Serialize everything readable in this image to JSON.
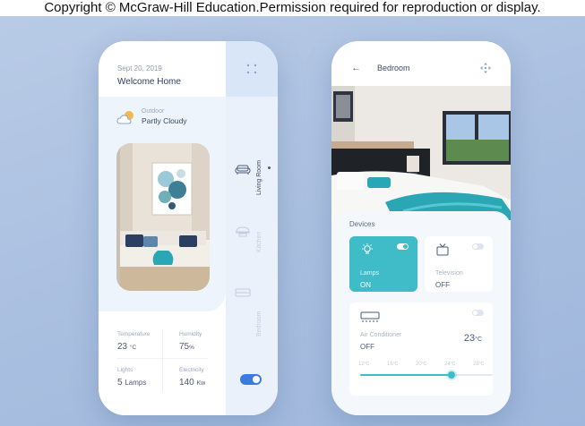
{
  "watermark": "Copyright © McGraw-Hill Education.Permission required for reproduction or display.",
  "colors": {
    "accent": "#3fbcc8",
    "toggle_blue": "#3b7be0",
    "text_dark": "#3a4a63"
  },
  "home": {
    "date": "Sept 20, 2019",
    "greeting": "Welcome Home",
    "weather": {
      "caption": "Outdoor",
      "condition": "Partly Cloudy",
      "icon": "partly-cloudy-icon"
    },
    "stats": {
      "temperature": {
        "label": "Temperature",
        "value": "23",
        "unit": "°C"
      },
      "humidity": {
        "label": "Humidity",
        "value": "75",
        "unit": "%"
      },
      "lights": {
        "label": "Lights",
        "value": "5",
        "unit": "Lamps"
      },
      "electricity": {
        "label": "Electricity",
        "value": "140",
        "unit": "Kw"
      }
    },
    "rooms": [
      {
        "label": "Living Room",
        "icon": "sofa-icon",
        "active": true
      },
      {
        "label": "Kitchen",
        "icon": "cooking-pot-icon",
        "active": false
      },
      {
        "label": "Bedroom",
        "icon": "bed-icon",
        "active": false
      }
    ],
    "master_toggle_on": true
  },
  "bedroom": {
    "title": "Bedroom",
    "devices_title": "Devices",
    "devices": [
      {
        "name": "Lamps",
        "state": "ON",
        "icon": "lamp-icon",
        "on": true
      },
      {
        "name": "Television",
        "state": "OFF",
        "icon": "tv-icon",
        "on": false
      }
    ],
    "ac": {
      "name": "Air Conditioner",
      "state": "OFF",
      "temperature": "23",
      "temp_unit": "°C",
      "icon": "air-conditioner-icon",
      "scale": [
        "12",
        "16",
        "20",
        "24",
        "28"
      ],
      "scale_unit": "°C",
      "setpoint": 23
    }
  }
}
